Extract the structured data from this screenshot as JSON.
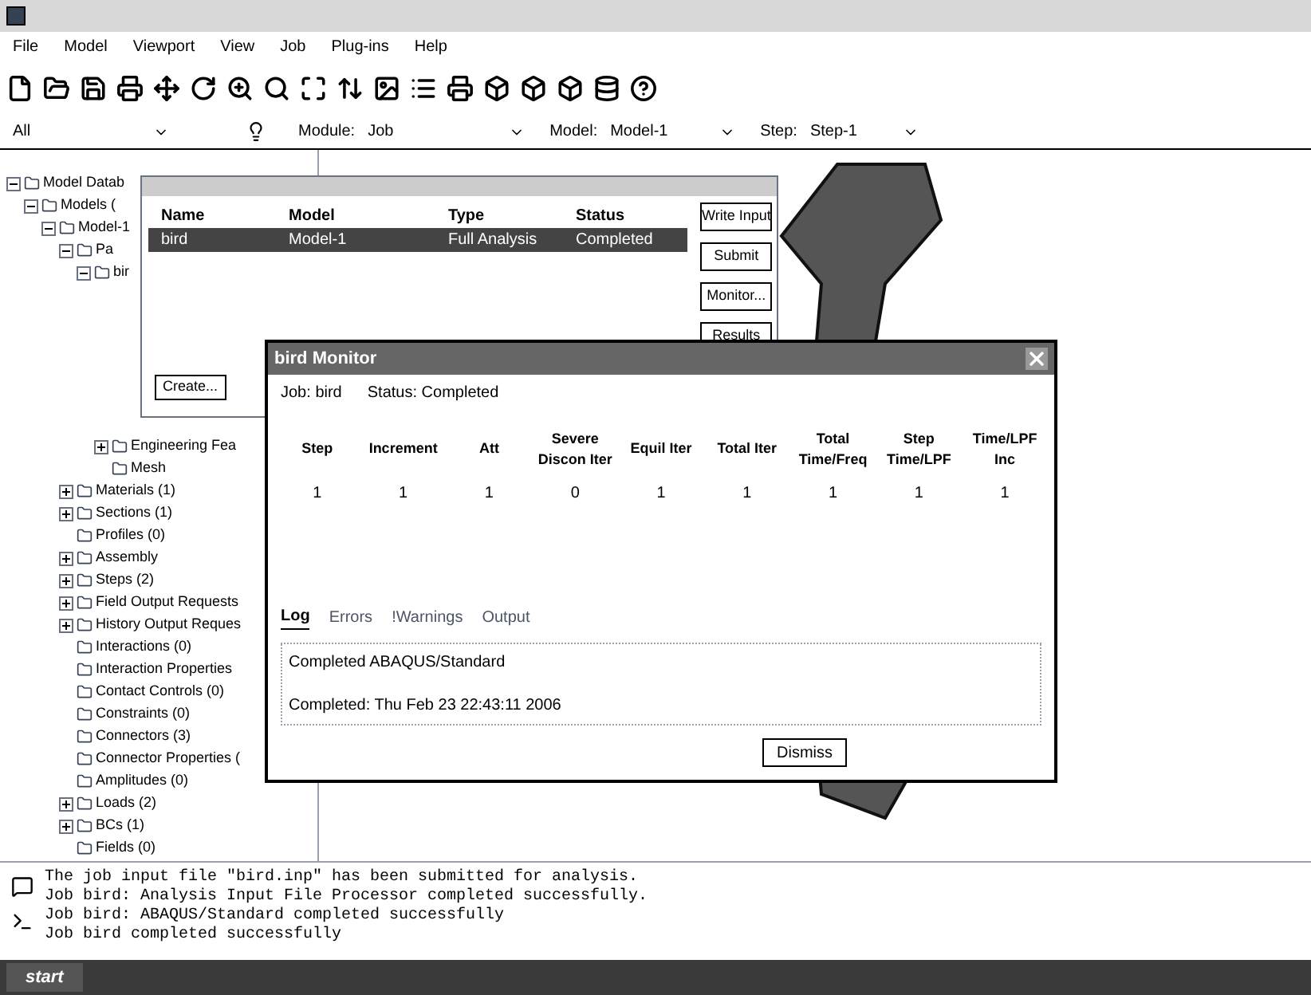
{
  "menu": [
    "File",
    "Model",
    "Viewport",
    "View",
    "Job",
    "Plug-ins",
    "Help"
  ],
  "context": {
    "filter": "All",
    "module_label": "Module:",
    "module": "Job",
    "model_label": "Model:",
    "model": "Model-1",
    "step_label": "Step:",
    "step": "Step-1"
  },
  "tree": [
    {
      "label": "Model Datab",
      "expanded": true,
      "children": [
        {
          "label": "Models (",
          "expanded": true,
          "children": [
            {
              "label": "Model-1",
              "expanded": true,
              "children": [
                {
                  "label": "Pa",
                  "expanded": true,
                  "children": [
                    {
                      "label": "bir",
                      "expanded": true,
                      "children": [
                        {
                          "label": "Engineering Fea",
                          "expanded": false
                        },
                        {
                          "label": "Mesh"
                        }
                      ]
                    }
                  ]
                },
                {
                  "label": "Materials (1)",
                  "expanded": false
                },
                {
                  "label": "Sections (1)",
                  "expanded": false
                },
                {
                  "label": "Profiles (0)"
                },
                {
                  "label": "Assembly",
                  "expanded": false
                },
                {
                  "label": "Steps (2)",
                  "expanded": false
                },
                {
                  "label": "Field Output Requests",
                  "expanded": false
                },
                {
                  "label": "History Output Reques",
                  "expanded": false
                },
                {
                  "label": "Interactions (0)"
                },
                {
                  "label": "Interaction Properties"
                },
                {
                  "label": "Contact Controls (0)"
                },
                {
                  "label": "Constraints (0)"
                },
                {
                  "label": "Connectors (3)"
                },
                {
                  "label": "Connector Properties ("
                },
                {
                  "label": "Amplitudes (0)"
                },
                {
                  "label": "Loads (2)",
                  "expanded": false
                },
                {
                  "label": "BCs (1)",
                  "expanded": false
                },
                {
                  "label": "Fields (0)"
                }
              ]
            }
          ]
        }
      ]
    }
  ],
  "job_manager": {
    "columns": [
      "Name",
      "Model",
      "Type",
      "Status"
    ],
    "rows": [
      {
        "cells": [
          "bird",
          "Model-1",
          "Full Analysis",
          "Completed"
        ],
        "selected": true
      }
    ],
    "buttons": [
      "Write Input",
      "Submit",
      "Monitor...",
      "Results"
    ],
    "create_button": "Create..."
  },
  "monitor": {
    "title": "bird Monitor",
    "job_label": "Job:",
    "job": "bird",
    "status_label": "Status:",
    "status": "Completed",
    "columns": [
      "Step",
      "Increment",
      "Att",
      "Severe Discon Iter",
      "Equil Iter",
      "Total Iter",
      "Total Time/Freq",
      "Step Time/LPF",
      "Time/LPF Inc"
    ],
    "rows": [
      [
        "1",
        "1",
        "1",
        "0",
        "1",
        "1",
        "1",
        "1",
        "1"
      ]
    ],
    "tabs": [
      {
        "label": "Log",
        "selected": true
      },
      {
        "label": "Errors",
        "selected": false
      },
      {
        "label": "!Warnings",
        "selected": false
      },
      {
        "label": "Output",
        "selected": false
      }
    ],
    "log": [
      "Completed  ABAQUS/Standard",
      "Completed: Thu Feb 23 22:43:11 2006"
    ],
    "dismiss": "Dismiss"
  },
  "messages": [
    "The job input file \"bird.inp\" has been submitted for analysis.",
    "Job bird: Analysis Input File Processor completed successfully.",
    "Job bird: ABAQUS/Standard completed successfully",
    "Job bird completed successfully"
  ],
  "taskbar": {
    "start": "start"
  }
}
